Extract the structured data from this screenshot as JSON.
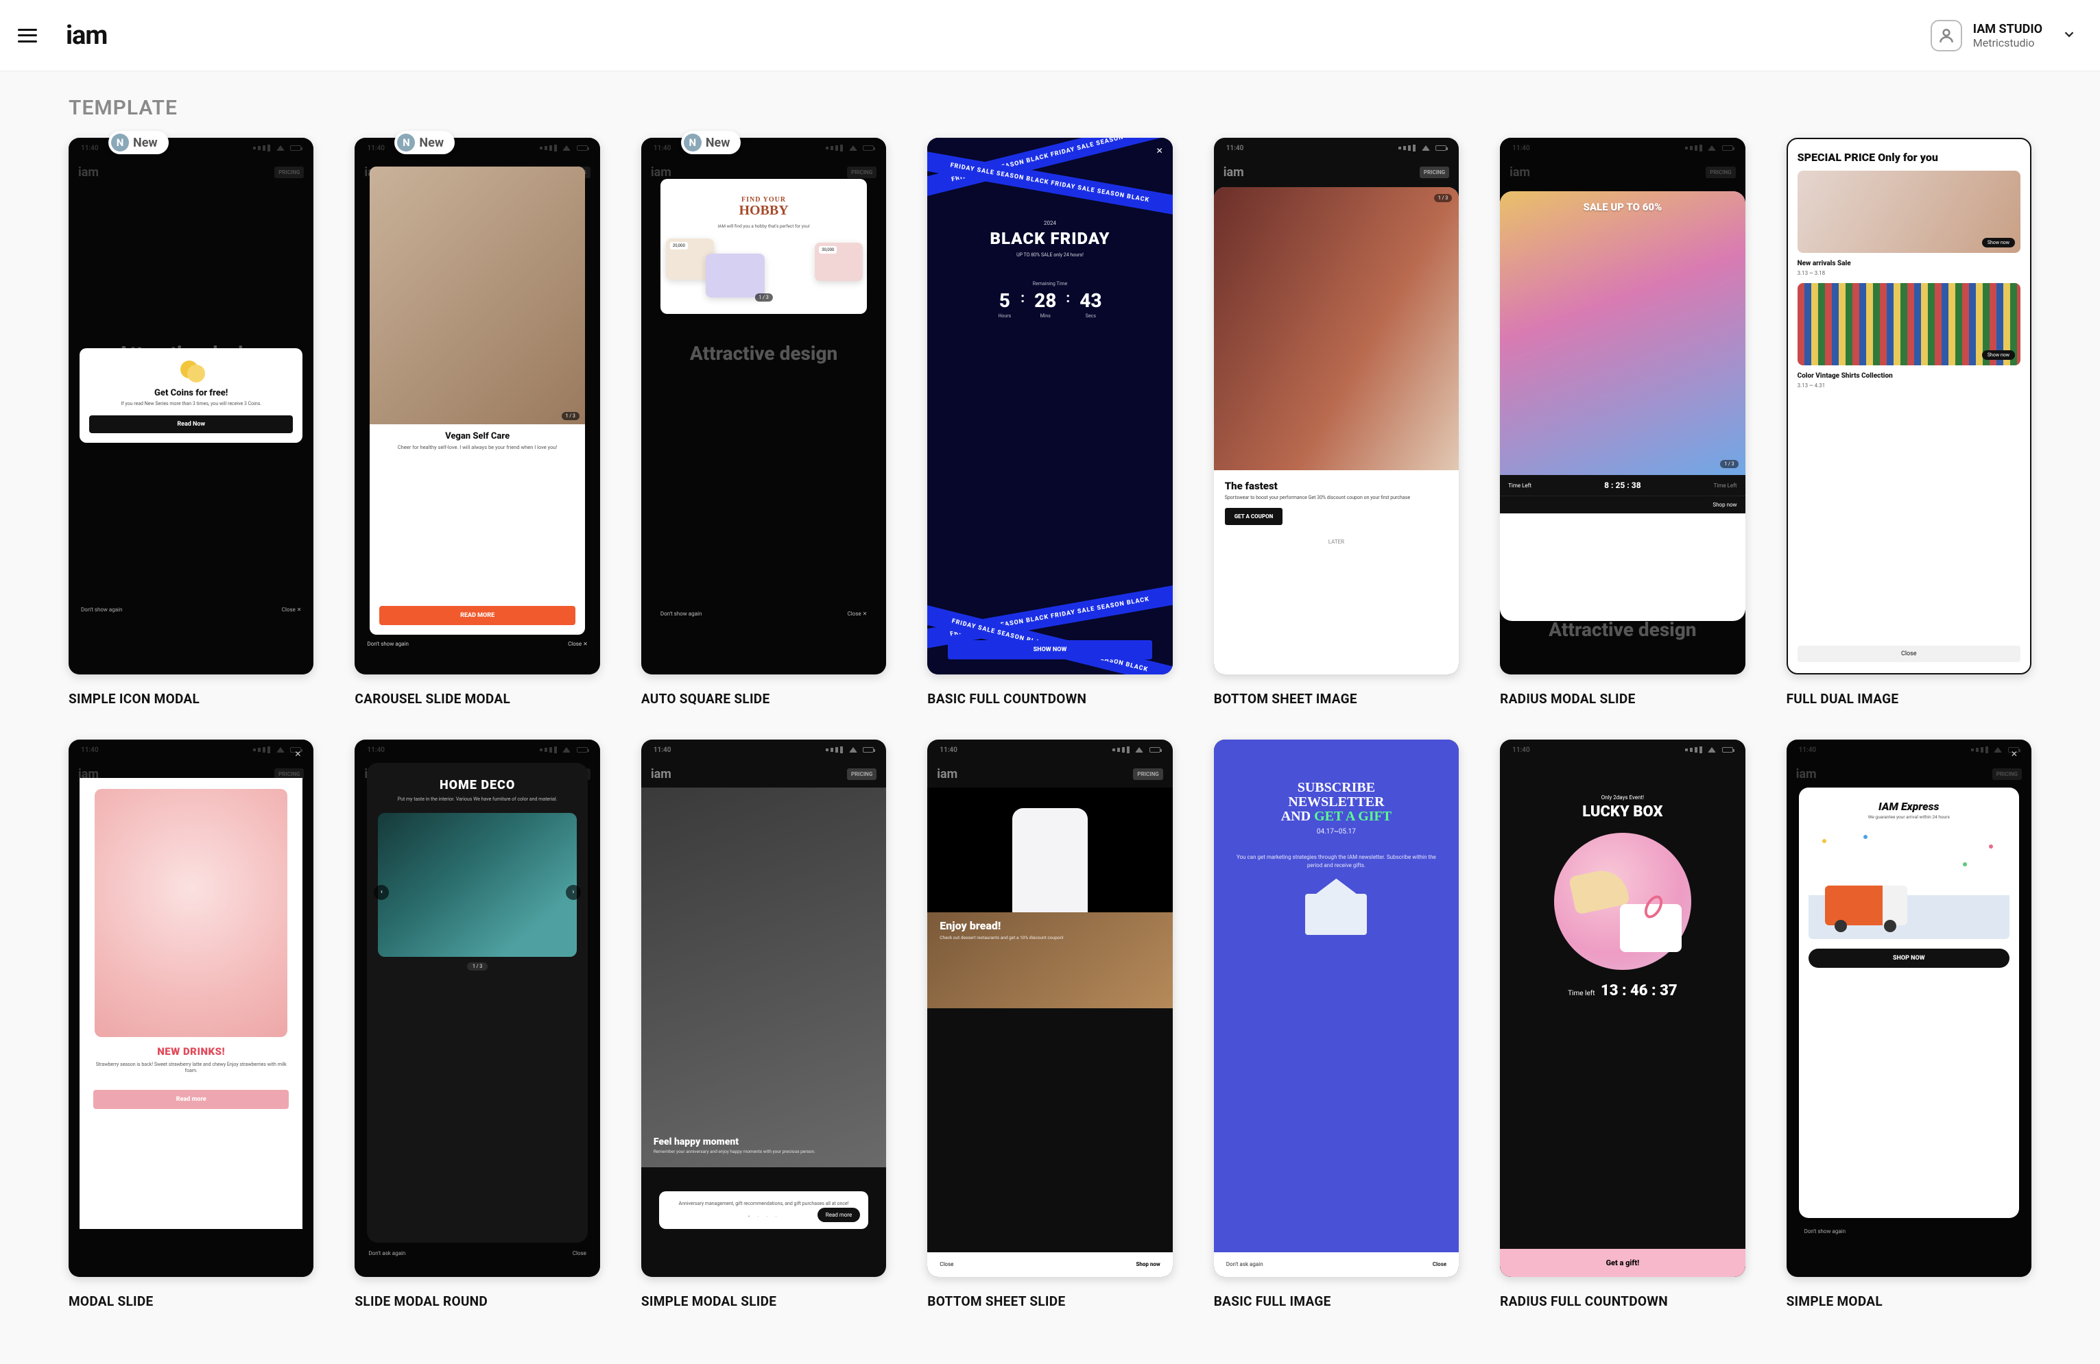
{
  "header": {
    "logo": "iam",
    "user_name": "IAM STUDIO",
    "user_sub": "Metricstudio"
  },
  "section_title": "TEMPLATE",
  "badges": {
    "new": "New",
    "new_letter": "N"
  },
  "common": {
    "time": "11:40",
    "pricing": "PRICING",
    "phone_logo": "iam",
    "dont_show": "Don't show again",
    "dont_ask": "Don't ask again",
    "close": "Close",
    "close_x": "Close ✕",
    "bg_heading": "Attractive design"
  },
  "templates": [
    {
      "title": "SIMPLE ICON MODAL",
      "new": true,
      "modal_title": "Get Coins for free!",
      "modal_sub": "If you read New Series more than 3 times, you will receive 3 Coins.",
      "modal_cta": "Read Now"
    },
    {
      "title": "CAROUSEL SLIDE MODAL",
      "new": true,
      "modal_title": "Vegan Self Care",
      "modal_sub": "Cheer for healthy self-love. I will always be your friend when I love you!",
      "modal_cta": "READ MORE",
      "pag": "1 / 3"
    },
    {
      "title": "AUTO SQUARE SLIDE",
      "new": true,
      "line1": "FIND YOUR",
      "line2": "HOBBY",
      "sub": "IAM will find you a hobby that's perfect for you!",
      "pag": "1 / 3",
      "tag1": "20,000",
      "tag2": "30,000"
    },
    {
      "title": "BASIC FULL COUNTDOWN",
      "ribbon": "FRIDAY SALE SEASON BLACK FRIDAY SALE SEASON BLACK",
      "year": "2024",
      "heading": "BLACK FRIDAY",
      "sub": "UP TO 80% SALE only 24 hours!",
      "cd_label": "Remaining Time",
      "h": "5",
      "m": "28",
      "s": "43",
      "hl": "Hours",
      "ml": "Mins",
      "sl": "Secs",
      "cta": "SHOW NOW"
    },
    {
      "title": "BOTTOM SHEET IMAGE",
      "heading": "The fastest",
      "sub": "Sportswear to boost your performance\nGet 30% discount coupon on your first purchase",
      "cta": "GET A COUPON",
      "later": "LATER",
      "pag": "1 / 3"
    },
    {
      "title": "RADIUS MODAL SLIDE",
      "heading": "SALE UP TO 60%",
      "left": "Time Left",
      "mid": "8 : 25 : 38",
      "right": "Shop now",
      "pag": "1 / 3",
      "right2": "Time Left"
    },
    {
      "title": "FULL DUAL IMAGE",
      "heading": "SPECIAL PRICE Only for you",
      "cap1": "New arrivals Sale",
      "date1": "3.13 ~ 3.18",
      "cap2": "Color Vintage Shirts Collection",
      "date2": "3.13 ~ 4.31",
      "shop": "Show now",
      "close": "Close"
    },
    {
      "title": "MODAL SLIDE",
      "heading": "NEW DRINKS!",
      "sub": "Strawberry season is back!\nSweet strawberry latte and chewy\nEnjoy strawberries with milk foam.",
      "cta": "Read more"
    },
    {
      "title": "SLIDE MODAL ROUND",
      "heading": "HOME DECO",
      "sub": "Put my taste in the interior. Various\nWe have furniture of color and\nmaterial.",
      "pag": "1 / 3"
    },
    {
      "title": "SIMPLE MODAL SLIDE",
      "over_h": "Feel happy moment",
      "over_p": "Remember your anniversary and enjoy happy\nmoments with your precious person.",
      "box_p": "Anniversary management,\ngift recommendations, and gift\npurchases all at once!",
      "cta": "Read more"
    },
    {
      "title": "BOTTOM SHEET SLIDE",
      "over_h": "Enjoy bread!",
      "over_p": "Check out dessert restaurants and get a 10%\ndiscount coupon!",
      "close": "Close",
      "shop": "Shop now"
    },
    {
      "title": "BASIC FULL IMAGE",
      "h1": "SUBSCRIBE",
      "h2": "NEWSLETTER",
      "h3a": "AND ",
      "h3b": "GET A GIFT",
      "date": "04.17~05.17",
      "p": "You can get marketing strategies\nthrough the IAM newsletter.\nSubscribe within the period and\nreceive gifts.",
      "close": "Close"
    },
    {
      "title": "RADIUS FULL COUNTDOWN",
      "banner": "Only 2days Event!",
      "heading": "LUCKY BOX",
      "cd_label": "Time left",
      "cd": "13 : 46 : 37",
      "cta": "Get a gift!"
    },
    {
      "title": "SIMPLE MODAL",
      "heading": "IAM Express",
      "sub": "We guarantee your arrival within 24 hours",
      "cta": "SHOP NOW"
    }
  ]
}
